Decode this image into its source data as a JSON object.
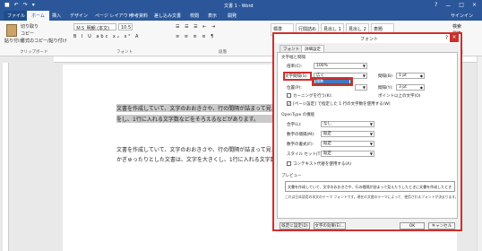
{
  "window": {
    "qat_icons": [
      "save-icon",
      "undo-icon",
      "redo-icon",
      "customize-icon"
    ],
    "title": "文書 1 - Word",
    "controls": [
      "?",
      "ー",
      "□",
      "×"
    ]
  },
  "tabs": [
    "ファイル",
    "ホーム",
    "挿入",
    "デザイン",
    "ページ レイアウト",
    "参考資料",
    "差し込み文書",
    "校閲",
    "表示",
    "開発"
  ],
  "user": "サインイン",
  "ribbon": {
    "clipboard": {
      "paste": "貼り付け",
      "cut": "切り取り",
      "copy": "コピー",
      "format_painter": "書式のコピー/貼り付け",
      "group": "クリップボード"
    },
    "font": {
      "name": "ＭＳ 明朝 (本文)",
      "size": "10.5",
      "group": "フォント"
    },
    "paragraph": {
      "group": "段落"
    },
    "styles": [
      "標準",
      "行間詰め",
      "見出し 1",
      "見出し 2",
      "表題"
    ],
    "editing": {
      "find": "検索",
      "replace": "置換",
      "select": "選択",
      "group": "編集"
    }
  },
  "document": {
    "lines": [
      "文書を作成していて、文字のおおきさや、行の間隔が詰まって見えたり広がったりしたときに調整",
      "をし、1行に入れる文字数などをそろえるなどがあります。",
      "文書を作成していて、文字のおおきさや、行の間隔が詰まって見えたりしたときに調整",
      "かぎゅったりとした文書は、文字を大きくし、1行に入れる文字数などをそろえるなどが"
    ]
  },
  "dialog": {
    "title": "フォント",
    "help": "?",
    "close": "×",
    "tabs": [
      "フォント",
      "詳細設定"
    ],
    "spacing_section": "文字幅と間隔",
    "scale_label": "倍率(C):",
    "scale_value": "100%",
    "spacing_label": "文字間隔(S):",
    "spacing_value": "広く",
    "spacing_dropdown_item": "標準",
    "spacing_width_label": "間隔(B):",
    "spacing_width_value": "1 pt",
    "position_label": "位置(P):",
    "position_value": "標準",
    "position_width_label": "間隔(Y):",
    "position_width_value": "3 pt",
    "kerning_label": "カーニングを行う(K):",
    "kerning_suffix": "ポイント以上の文字(O)",
    "grid_label": "[ページ設定] で指定した 1 行の文字数を使用する(W)",
    "opentype_section": "OpenType の機能",
    "ligatures_label": "合字(L):",
    "ligatures_value": "なし",
    "number_spacing_label": "数字の間隔(M):",
    "number_spacing_value": "既定",
    "number_forms_label": "数字の書式(F):",
    "number_forms_value": "既定",
    "stylistic_sets_label": "スタイル セット(T):",
    "stylistic_sets_value": "既定",
    "contextual_label": "コンテキスト代替を使用する(A)",
    "preview_section": "プレビュー",
    "preview_text": "文書を作成していて、文字のおおきさや、行の間隔が詰まって見えたりしたときに文書を作成したとき",
    "note": "これは日本語用の本文のテーマ フォントです。現在の文書のテーマによって、使用されるフォントが決まります。",
    "buttons": {
      "default": "既定に設定(D)",
      "effects": "文字の効果(E)...",
      "ok": "OK",
      "cancel": "キャンセル"
    }
  }
}
